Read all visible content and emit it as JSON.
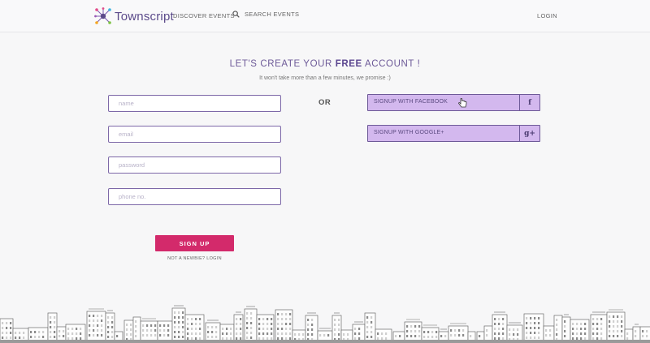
{
  "header": {
    "brand": "Townscript",
    "nav_discover": "DISCOVER EVENTS",
    "nav_search": "SEARCH EVENTS",
    "nav_login": "LOGIN"
  },
  "hero": {
    "headline_pre": "LET'S CREATE YOUR ",
    "headline_strong": "FREE",
    "headline_post": " ACCOUNT !",
    "subtitle": "It won't take more than a few minutes, we promise :)"
  },
  "form": {
    "name_placeholder": "name",
    "email_placeholder": "email",
    "password_placeholder": "password",
    "phone_placeholder": "phone no.",
    "signup_label": "SIGN UP",
    "login_link": "NOT A NEWBIE? LOGIN"
  },
  "divider": {
    "or_label": "OR"
  },
  "social": {
    "facebook_label": "SIGNUP WITH FACEBOOK",
    "facebook_icon": "f",
    "google_label": "SIGNUP WITH GOOGLE+",
    "google_icon": "g+"
  },
  "colors": {
    "brand_purple": "#5b4a8a",
    "input_border": "#7d68a8",
    "social_bg": "#d3b8ee",
    "signup_pink": "#d32a6b"
  }
}
